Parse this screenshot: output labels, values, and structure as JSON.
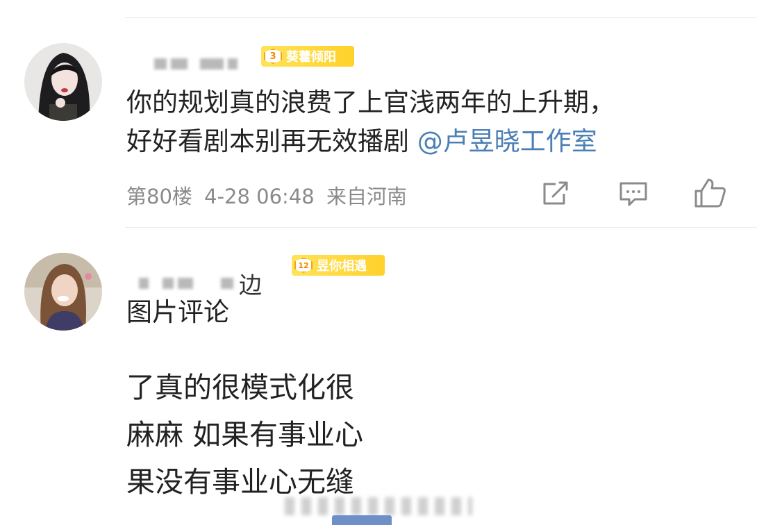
{
  "comments": [
    {
      "badge_level": "3",
      "badge_text": "葵藿倾阳",
      "text_line1": "你的规划真的浪费了上官浅两年的上升期，",
      "text_line2": "好好看剧本别再无效播剧 ",
      "mention": "@卢昱晓工作室",
      "floor": "第80楼",
      "time": "4-28 06:48",
      "location": "来自河南",
      "icons": [
        "share-icon",
        "comment-icon",
        "like-icon"
      ]
    },
    {
      "name_suffix": "边",
      "badge_level": "12",
      "badge_text": "昱你相遇",
      "text": "图片评论",
      "image_text_lines": [
        "了真的很模式化很",
        "麻麻 如果有事业心",
        "果没有事业心无缝"
      ]
    }
  ],
  "colors": {
    "mention": "#4a7fb5",
    "badge": "#ffd12a",
    "meta": "#8a8a8a"
  }
}
